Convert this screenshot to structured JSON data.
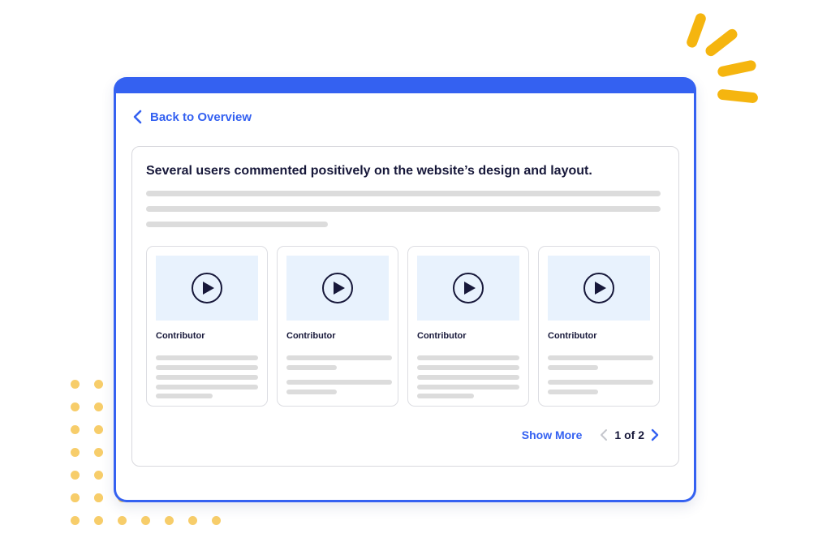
{
  "colors": {
    "accent": "#3461f1",
    "spark": "#f5b50f",
    "dots": "#f7cd6a",
    "thumb_bg": "#e8f2fd",
    "text_dark": "#17183a",
    "placeholder_line": "#dcdcdc"
  },
  "nav": {
    "back_label": "Back to Overview",
    "back_icon": "chevron-left-icon"
  },
  "summary": {
    "headline": "Several users commented positively on the website’s design and layout."
  },
  "videos": [
    {
      "contributor": "Contributor",
      "icon": "play-icon"
    },
    {
      "contributor": "Contributor",
      "icon": "play-icon"
    },
    {
      "contributor": "Contributor",
      "icon": "play-icon"
    },
    {
      "contributor": "Contributor",
      "icon": "play-icon"
    }
  ],
  "footer": {
    "show_more_label": "Show More",
    "page_indicator": "1 of 2",
    "prev_icon": "chevron-left-icon",
    "next_icon": "chevron-right-icon"
  }
}
